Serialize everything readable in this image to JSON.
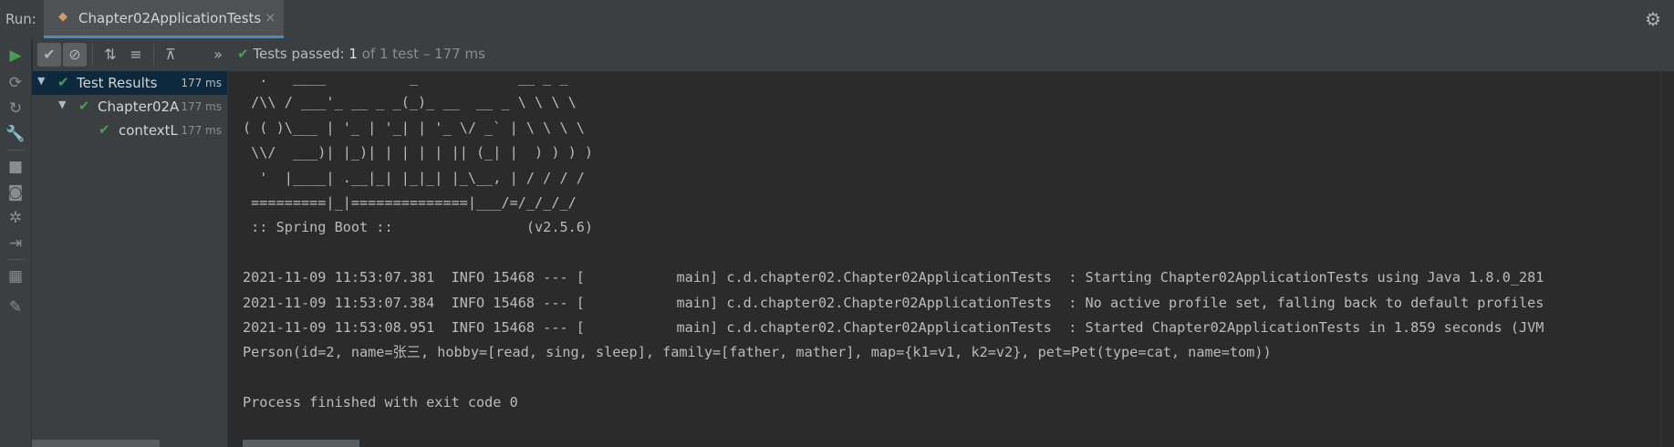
{
  "header": {
    "run_label": "Run:",
    "tab_title": "Chapter02ApplicationTests",
    "tab_icon": "test-run-icon",
    "tab_close": "×",
    "settings_icon": "gear-icon"
  },
  "toolbar": {
    "summary_label": "Tests passed:",
    "summary_count": "1",
    "summary_rest": "of 1 test – 177 ms",
    "buttons": [
      "show-passed-icon",
      "show-ignored-icon",
      "sort-alpha-icon",
      "sort-duration-icon",
      "collapse-all-icon",
      "more-icon"
    ]
  },
  "left_strip": {
    "icons": [
      "rerun-icon",
      "rerun-failed-icon",
      "toggle-auto-test-icon",
      "wrench-icon",
      "stop-icon",
      "camera-icon",
      "gear-export-icon",
      "exit-icon",
      "layout-icon",
      "pin-icon"
    ]
  },
  "tree": {
    "rows": [
      {
        "name": "Test Results",
        "time": "177 ms"
      },
      {
        "name": "Chapter02A",
        "time": "177 ms"
      },
      {
        "name": "contextL",
        "time": "177 ms"
      }
    ]
  },
  "console": {
    "banner": [
      "  .   ____          _            __ _ _",
      " /\\\\ / ___'_ __ _ _(_)_ __  __ _ \\ \\ \\ \\",
      "( ( )\\___ | '_ | '_| | '_ \\/ _` | \\ \\ \\ \\",
      " \\\\/  ___)| |_)| | | | | || (_| |  ) ) ) )",
      "  '  |____| .__|_| |_|_| |_\\__, | / / / /",
      " =========|_|==============|___/=/_/_/_/",
      " :: Spring Boot ::                (v2.5.6)"
    ],
    "blank1": "",
    "log1": "2021-11-09 11:53:07.381  INFO 15468 --- [           main] c.d.chapter02.Chapter02ApplicationTests  : Starting Chapter02ApplicationTests using Java 1.8.0_281",
    "log2": "2021-11-09 11:53:07.384  INFO 15468 --- [           main] c.d.chapter02.Chapter02ApplicationTests  : No active profile set, falling back to default profiles",
    "log3": "2021-11-09 11:53:08.951  INFO 15468 --- [           main] c.d.chapter02.Chapter02ApplicationTests  : Started Chapter02ApplicationTests in 1.859 seconds (JVM",
    "person": "Person(id=2, name=张三, hobby=[read, sing, sleep], family=[father, mather], map={k1=v1, k2=v2}, pet=Pet(type=cat, name=tom))",
    "blank2": "",
    "exit": "Process finished with exit code 0"
  }
}
